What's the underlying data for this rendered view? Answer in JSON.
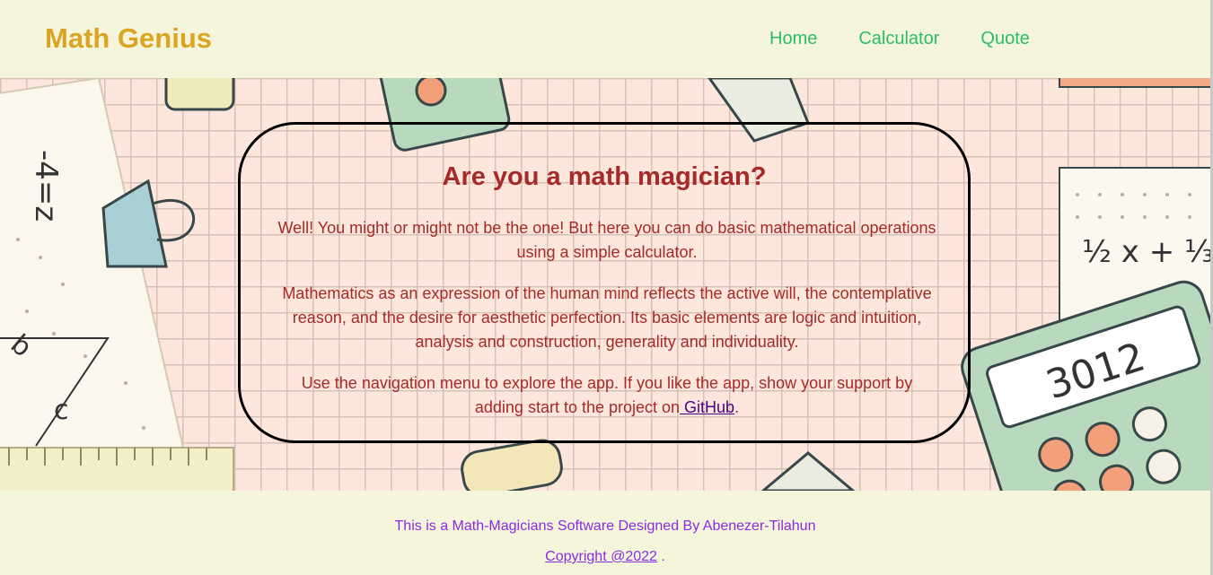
{
  "header": {
    "brand": "Math Genius",
    "nav": [
      "Home",
      "Calculator",
      "Quote"
    ]
  },
  "hero": {
    "title": "Are you a math magician?",
    "paragraph1": "Well! You might or might not be the one! But here you can do basic mathematical operations using a simple calculator.",
    "paragraph2": "Mathematics as an expression of the human mind reflects the active will, the contemplative reason, and the desire for aesthetic perfection. Its basic elements are logic and intuition, analysis and construction, generality and individuality.",
    "paragraph3_prefix": "Use the navigation menu to explore the app. If you like the app, show your support by adding start to the project on",
    "github_link": " GitHub",
    "paragraph3_suffix": ".",
    "calculator_display": "3012",
    "fraction_text": "½ x + ⅓"
  },
  "footer": {
    "credit": "This is a Math-Magicians Software Designed By Abenezer-Tilahun",
    "copyright_link": "Copyright @2022",
    "copyright_suffix": " ."
  },
  "colors": {
    "background": "#f5f5dc",
    "brand": "#daa520",
    "nav": "#2bbd68",
    "card_text": "#a52a2a",
    "link": "#4b0082",
    "footer_text": "#8a2be2"
  }
}
